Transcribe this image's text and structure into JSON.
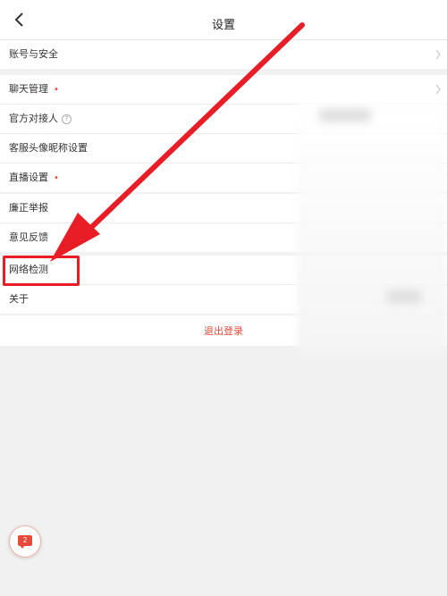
{
  "header": {
    "title": "设置"
  },
  "groups": [
    {
      "items": [
        {
          "label": "账号与安全"
        }
      ]
    },
    {
      "items": [
        {
          "label": "聊天管理",
          "dot": "•"
        },
        {
          "label": "官方对接人",
          "info": "?"
        },
        {
          "label": "客服头像昵称设置"
        },
        {
          "label": "直播设置",
          "dot": "•"
        }
      ]
    },
    {
      "items": [
        {
          "label": "廉正举报"
        },
        {
          "label": "意见反馈"
        }
      ]
    },
    {
      "items": [
        {
          "label": "网络检测"
        },
        {
          "label": "关于"
        }
      ]
    }
  ],
  "logout": {
    "label": "退出登录"
  },
  "chat": {
    "badge_count": "2"
  },
  "colors": {
    "accent": "#e8483a",
    "annotation": "#e81d25"
  }
}
